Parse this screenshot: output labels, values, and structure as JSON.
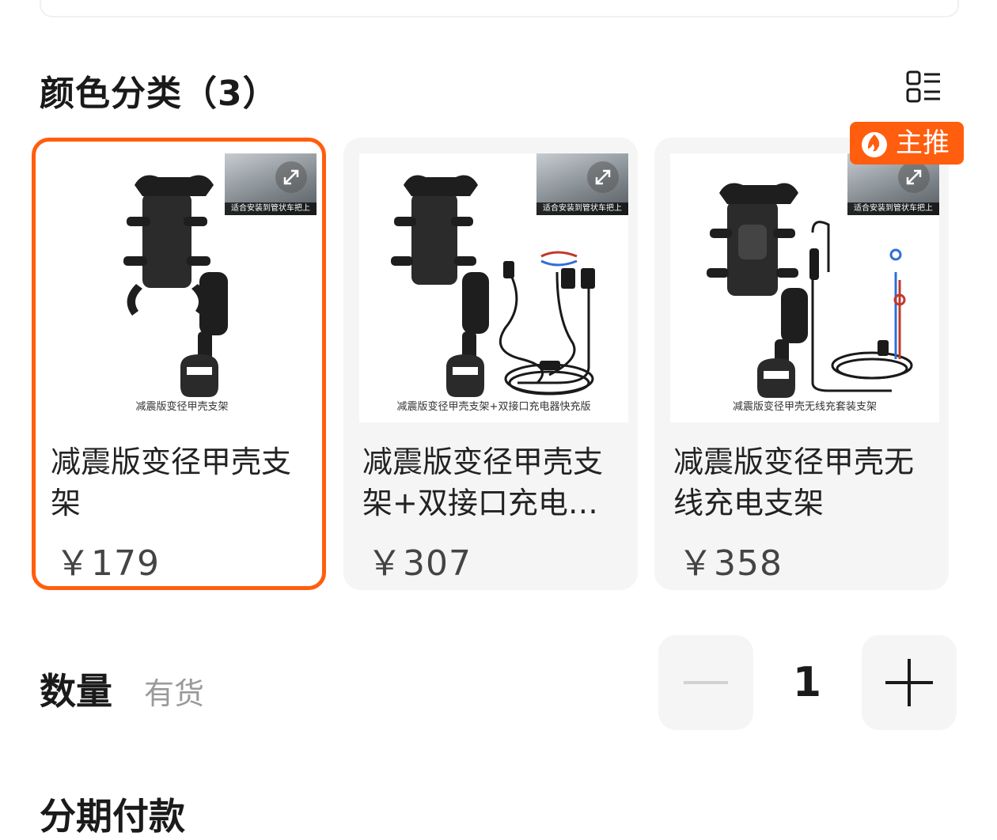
{
  "colors": {
    "accent": "#ff5e0e",
    "card_bg": "#f5f5f5",
    "text": "#1a1a1a",
    "muted": "#9a9a9a"
  },
  "section": {
    "title": "颜色分类（3）",
    "view_toggle_icon": "list-grid-icon"
  },
  "options": [
    {
      "name": "减震版变径甲壳支架",
      "price": "￥179",
      "image_caption": "减震版变径甲壳支架",
      "inset_caption": "适合安装到管状车把上",
      "selected": true,
      "accessory": "none"
    },
    {
      "name": "减震版变径甲壳支架+双接口充电器快充版",
      "price": "￥307",
      "image_caption": "减震版变径甲壳支架+双接口充电器快充版",
      "inset_caption": "适合安装到管状车把上",
      "selected": false,
      "accessory": "charger"
    },
    {
      "name": "减震版变径甲壳无线充电支架",
      "price": "￥358",
      "image_caption": "减震版变径甲壳无线充套装支架",
      "inset_caption": "适合安装到管状车把上",
      "selected": false,
      "accessory": "wireless"
    }
  ],
  "badge": {
    "label": "主推",
    "icon": "flame-icon"
  },
  "quantity": {
    "label": "数量",
    "stock": "有货",
    "value": "1"
  },
  "next_section": {
    "title": "分期付款"
  }
}
